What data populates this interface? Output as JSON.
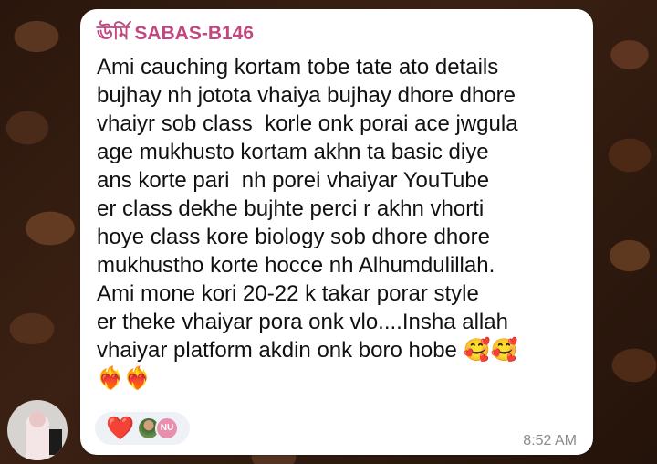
{
  "message": {
    "sender": "ঊর্মি SABAS-B146",
    "lines": [
      "Ami cauching kortam tobe tate ato details",
      "bujhay nh jotota vhaiya bujhay dhore dhore",
      "vhaiyr sob class  korle onk porai ace jwgula",
      "age mukhusto kortam akhn ta basic diye",
      "ans korte pari  nh porei vhaiyar YouTube",
      "er class dekhe bujhte perci r akhn vhorti",
      "hoye class kore biology sob dhore dhore",
      "mukhustho korte hocce nh Alhumdulillah.",
      "Ami mone kori 20-22 k takar porar style",
      "er theke vhaiyar pora onk vlo....Insha allah",
      "vhaiyar platform akdin onk boro hobe 🥰🥰",
      "❤️‍🔥❤️‍🔥"
    ],
    "time": "8:52 AM"
  },
  "reactions": {
    "emoji": "❤️",
    "reactor_initials": "NU"
  },
  "colors": {
    "sender_name": "#c2477f",
    "bubble": "#ffffff",
    "reaction_pill": "#eef1f6"
  }
}
